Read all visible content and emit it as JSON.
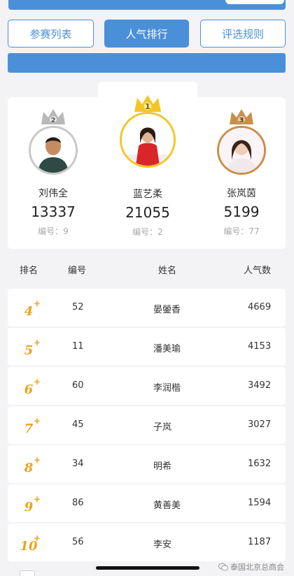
{
  "tabs": [
    {
      "label": "参赛列表",
      "active": false
    },
    {
      "label": "人气排行",
      "active": true
    },
    {
      "label": "评选规则",
      "active": false
    }
  ],
  "podium": {
    "first": {
      "rank": "1",
      "name": "蓝艺柔",
      "votes": "21055",
      "id_label": "编号：2"
    },
    "second": {
      "rank": "2",
      "name": "刘伟全",
      "votes": "13337",
      "id_label": "编号：9"
    },
    "third": {
      "rank": "3",
      "name": "张岚茵",
      "votes": "5199",
      "id_label": "编号：77"
    }
  },
  "table": {
    "headers": {
      "rank": "排名",
      "number": "编号",
      "name": "姓名",
      "votes": "人气数"
    },
    "rows": [
      {
        "rank": "4",
        "number": "52",
        "name": "晏鎣香",
        "votes": "4669"
      },
      {
        "rank": "5",
        "number": "11",
        "name": "潘美瑜",
        "votes": "4153"
      },
      {
        "rank": "6",
        "number": "60",
        "name": "李润楷",
        "votes": "3492"
      },
      {
        "rank": "7",
        "number": "45",
        "name": "子岚",
        "votes": "3027"
      },
      {
        "rank": "8",
        "number": "34",
        "name": "明希",
        "votes": "1632"
      },
      {
        "rank": "9",
        "number": "86",
        "name": "黄善美",
        "votes": "1594"
      },
      {
        "rank": "10",
        "number": "56",
        "name": "李安",
        "votes": "1187"
      }
    ]
  },
  "watermark": {
    "text": "泰国北京总商会",
    "icon": "wechat-icon"
  },
  "colors": {
    "accent": "#4a90d9",
    "gold": "#f3c623",
    "silver": "#b8b8b8",
    "bronze": "#c98f4a",
    "rank_gold": "#e8a51c"
  }
}
